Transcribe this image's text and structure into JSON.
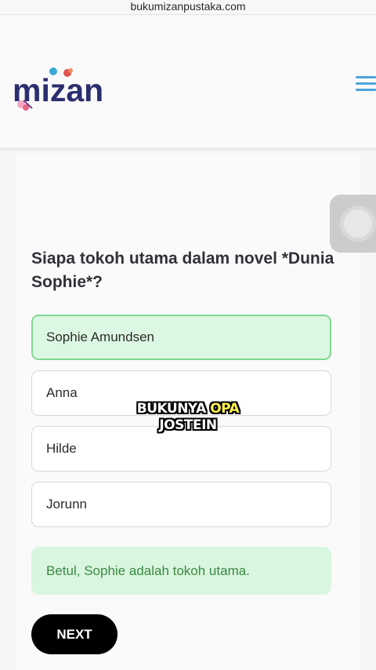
{
  "browser": {
    "url": "bukumizanpustaka.com"
  },
  "header": {
    "logo_text": "mizan",
    "menu_icon": "hamburger-menu-icon"
  },
  "quiz": {
    "question": "Siapa tokoh utama dalam novel *Dunia Sophie*?",
    "options": [
      {
        "label": "Sophie Amundsen",
        "state": "correct"
      },
      {
        "label": "Anna",
        "state": "default"
      },
      {
        "label": "Hilde",
        "state": "default"
      },
      {
        "label": "Jorunn",
        "state": "default"
      }
    ],
    "feedback": "Betul, Sophie adalah tokoh utama.",
    "next_label": "NEXT"
  },
  "overlay": {
    "caption_part1": "BUKUNYA",
    "caption_highlight": "OPA",
    "caption_line2": "JOSTEIN"
  },
  "colors": {
    "accent_blue": "#4da6d8",
    "logo_navy": "#2b2f6e",
    "correct_bg": "#dcf8e2",
    "correct_border": "#7fd893",
    "feedback_text": "#3a8a45"
  }
}
